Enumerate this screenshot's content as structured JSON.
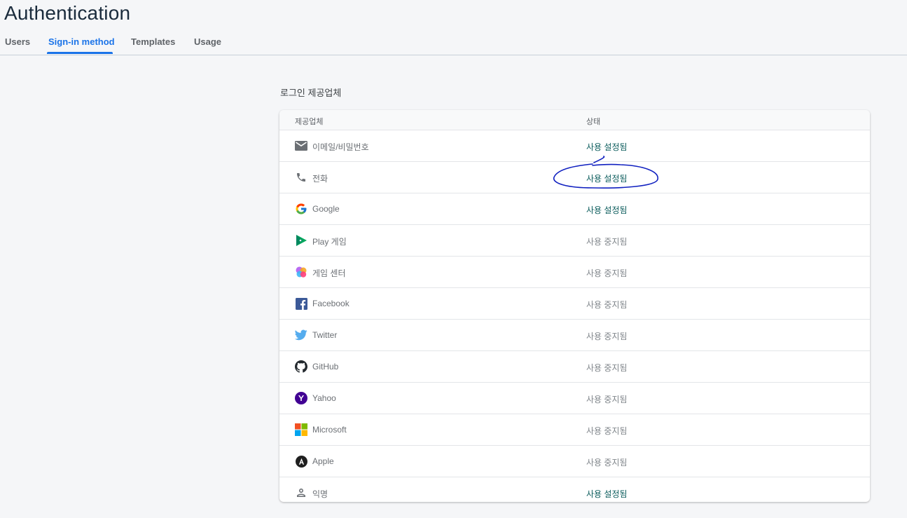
{
  "page": {
    "title": "Authentication"
  },
  "tabs": [
    {
      "label": "Users",
      "active": false
    },
    {
      "label": "Sign-in method",
      "active": true
    },
    {
      "label": "Templates",
      "active": false
    },
    {
      "label": "Usage",
      "active": false
    }
  ],
  "section": {
    "title": "로그인 제공업체"
  },
  "table": {
    "headers": {
      "provider": "제공업체",
      "status": "상태"
    },
    "rows": [
      {
        "icon": "mail-icon",
        "name": "이메일/비밀번호",
        "status": "사용 설정됨",
        "enabled": true
      },
      {
        "icon": "phone-icon",
        "name": "전화",
        "status": "사용 설정됨",
        "enabled": true
      },
      {
        "icon": "google-icon",
        "name": "Google",
        "status": "사용 설정됨",
        "enabled": true
      },
      {
        "icon": "play-games-icon",
        "name": "Play 게임",
        "status": "사용 중지됨",
        "enabled": false
      },
      {
        "icon": "game-center-icon",
        "name": "게임 센터",
        "status": "사용 중지됨",
        "enabled": false
      },
      {
        "icon": "facebook-icon",
        "name": "Facebook",
        "status": "사용 중지됨",
        "enabled": false
      },
      {
        "icon": "twitter-icon",
        "name": "Twitter",
        "status": "사용 중지됨",
        "enabled": false
      },
      {
        "icon": "github-icon",
        "name": "GitHub",
        "status": "사용 중지됨",
        "enabled": false
      },
      {
        "icon": "yahoo-icon",
        "name": "Yahoo",
        "status": "사용 중지됨",
        "enabled": false
      },
      {
        "icon": "microsoft-icon",
        "name": "Microsoft",
        "status": "사용 중지됨",
        "enabled": false
      },
      {
        "icon": "apple-icon",
        "name": "Apple",
        "status": "사용 중지됨",
        "enabled": false
      },
      {
        "icon": "person-icon",
        "name": "익명",
        "status": "사용 설정됨",
        "enabled": true
      }
    ]
  },
  "colors": {
    "accent": "#1a73e8",
    "enabled_status": "#0b5c5c",
    "disabled_status": "#80868b",
    "annotation": "#1020c0"
  }
}
